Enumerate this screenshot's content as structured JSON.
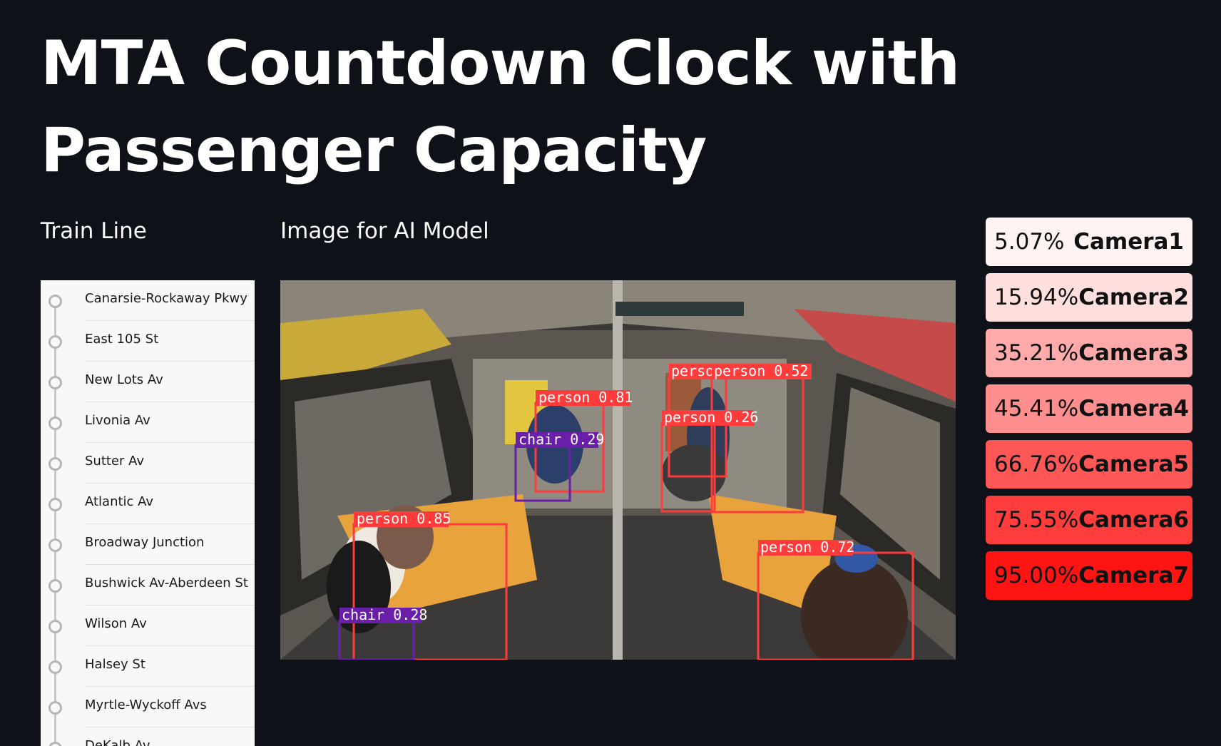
{
  "header": {
    "title_line1": "MTA Countdown Clock with",
    "title_line2": "Passenger Capacity"
  },
  "train_line": {
    "label": "Train Line",
    "stations": [
      "Canarsie-Rockaway Pkwy",
      "East 105 St",
      "New Lots Av",
      "Livonia Av",
      "Sutter Av",
      "Atlantic Av",
      "Broadway Junction",
      "Bushwick Av-Aberdeen St",
      "Wilson Av",
      "Halsey St",
      "Myrtle-Wyckoff Avs",
      "DeKalb Av"
    ]
  },
  "image_panel": {
    "label": "Image for AI Model",
    "detections": [
      {
        "label": "person 0.81",
        "color": "#ff3b3b"
      },
      {
        "label": "chair 0.29",
        "color": "#6a1fa8"
      },
      {
        "label": "perso",
        "color": "#ff3b3b"
      },
      {
        "label": "person 0.52",
        "color": "#ff3b3b"
      },
      {
        "label": "person 0.26",
        "color": "#ff3b3b"
      },
      {
        "label": "person 0.85",
        "color": "#ff3b3b"
      },
      {
        "label": "person 0.72",
        "color": "#ff3b3b"
      },
      {
        "label": "chair 0.28",
        "color": "#6a1fa8"
      }
    ]
  },
  "cameras": [
    {
      "percent": "5.07%",
      "name": "Camera1",
      "color": "#fff3f3"
    },
    {
      "percent": "15.94%",
      "name": "Camera2",
      "color": "#ffdede"
    },
    {
      "percent": "35.21%",
      "name": "Camera3",
      "color": "#ffaaaa"
    },
    {
      "percent": "45.41%",
      "name": "Camera4",
      "color": "#ff8f8f"
    },
    {
      "percent": "66.76%",
      "name": "Camera5",
      "color": "#ff5656"
    },
    {
      "percent": "75.55%",
      "name": "Camera6",
      "color": "#ff3d3d"
    },
    {
      "percent": "95.00%",
      "name": "Camera7",
      "color": "#ff1414"
    }
  ]
}
